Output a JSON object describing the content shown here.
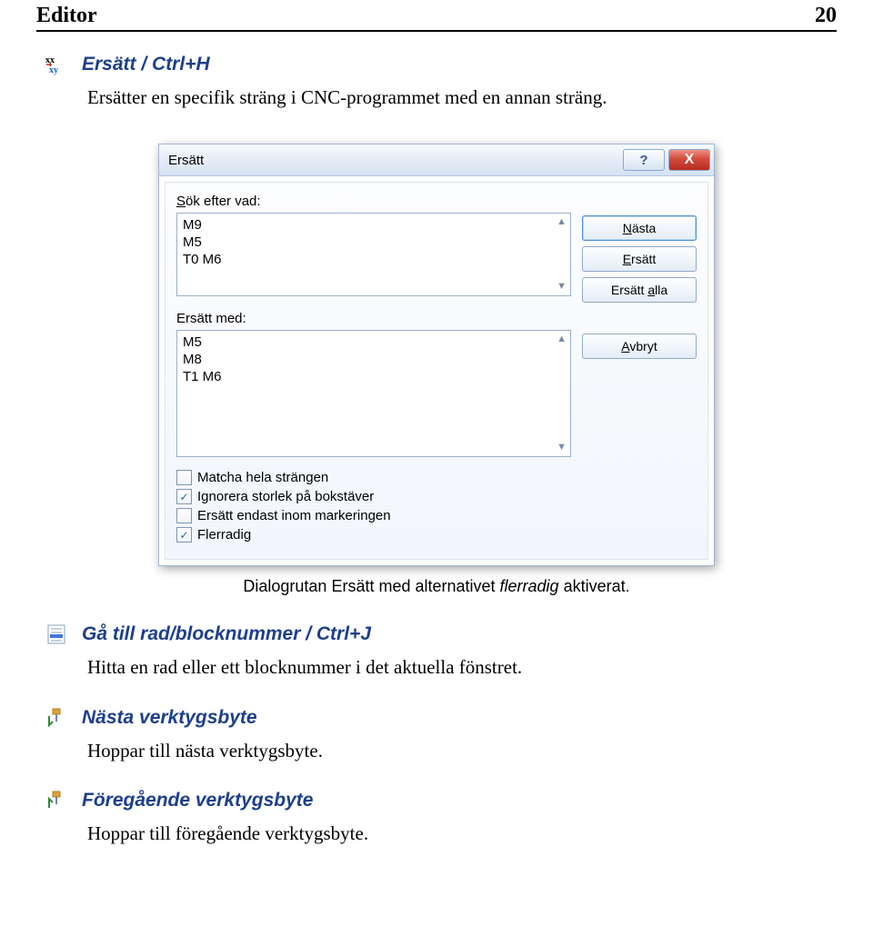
{
  "header": {
    "left": "Editor",
    "right": "20"
  },
  "sections": {
    "replace": {
      "title": "Ersätt / Ctrl+H",
      "body": "Ersätter en specifik sträng i CNC-programmet med en annan sträng."
    },
    "gotoline": {
      "title": "Gå till rad/blocknummer / Ctrl+J",
      "body": "Hitta en rad eller ett blocknummer i det aktuella fönstret."
    },
    "nexttool": {
      "title": "Nästa verktygsbyte",
      "body": "Hoppar till nästa verktygsbyte."
    },
    "prevtool": {
      "title": "Föregående verktygsbyte",
      "body": "Hoppar till föregående verktygsbyte."
    }
  },
  "dialog": {
    "title": "Ersätt",
    "help_glyph": "?",
    "close_glyph": "X",
    "search_label_pre": "S",
    "search_label_post": "ök efter vad:",
    "search_text": "M9\nM5\nT0 M6",
    "replace_label": "Ersätt med:",
    "replace_text": "M5\nM8\nT1 M6",
    "buttons": {
      "next_ul": "N",
      "next_rest": "ästa",
      "repl_ul": "E",
      "repl_rest": "rsätt",
      "all_pre": "Ersätt ",
      "all_ul": "a",
      "all_post": "lla",
      "cancel_ul": "A",
      "cancel_rest": "vbryt"
    },
    "checks": {
      "match_whole_ul": "M",
      "match_whole_rest": "atcha hela strängen",
      "ignore_case_ul": "I",
      "ignore_case_rest": "gnorera storlek på bokstäver",
      "sel_only": "Ersätt endast inom markeringen",
      "multiline_ul": "F",
      "multiline_rest": "lerradig",
      "match_whole_checked": false,
      "ignore_case_checked": true,
      "sel_only_checked": false,
      "multiline_checked": true
    }
  },
  "caption": {
    "pre": "Dialogrutan Ersätt med alternativet ",
    "em": "flerradig",
    "post": " aktiverat."
  },
  "glyphs": {
    "check": "✓"
  }
}
